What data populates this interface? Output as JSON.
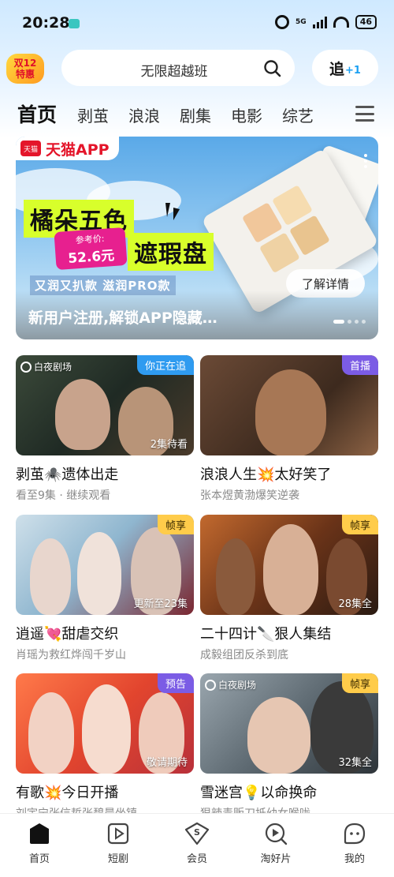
{
  "status_bar": {
    "time": "20:28",
    "network": "5G",
    "battery": "46"
  },
  "header": {
    "promo_badge": {
      "line1": "双12",
      "line2": "特惠"
    },
    "search": {
      "placeholder": "无限超越班"
    },
    "follow_button": {
      "label": "追",
      "plus": "+1"
    }
  },
  "tabs": [
    {
      "label": "首页",
      "active": true
    },
    {
      "label": "剥茧"
    },
    {
      "label": "浪浪"
    },
    {
      "label": "剧集"
    },
    {
      "label": "电影"
    },
    {
      "label": "综艺"
    }
  ],
  "banner": {
    "brand": "天猫APP",
    "brand_logo": "天猫",
    "headline1": "橘朵五色",
    "price_label": "参考价:",
    "price": "52.6元",
    "headline2": "遮瑕盘",
    "subline": "又润又扒款 滋润PRO款",
    "cta": "了解详情",
    "caption": "新用户注册,解锁APP隐藏…",
    "pager_total": 4,
    "pager_active": 1
  },
  "cards": [
    {
      "title": "剥茧🕷️遗体出走",
      "subtitle": "看至9集 · 继续观看",
      "badge": "你正在追",
      "badge_color": "blue",
      "overlay": "2集待看",
      "watermark": "白夜剧场"
    },
    {
      "title": "浪浪人生💥太好笑了",
      "subtitle": "张本煜黄渤爆笑逆袭",
      "badge": "首播",
      "badge_color": "purple",
      "overlay": "",
      "watermark": ""
    },
    {
      "title": "逍遥💘甜虐交织",
      "subtitle": "肖瑶为救红烨闯千岁山",
      "badge": "帧享",
      "badge_color": "orange",
      "overlay": "更新至23集",
      "watermark": ""
    },
    {
      "title": "二十四计🔪狠人集结",
      "subtitle": "成毅组团反杀到底",
      "badge": "帧享",
      "badge_color": "orange",
      "overlay": "28集全",
      "watermark": ""
    },
    {
      "title": "有歌💥今日开播",
      "subtitle": "刘宇宁张信哲张碧晨坐镇",
      "badge": "预告",
      "badge_color": "purple",
      "overlay": "敬请期待",
      "watermark": ""
    },
    {
      "title": "雪迷宫💡以命换命",
      "subtitle": "狠辣毒贩刀抵幼女喉咙",
      "badge": "帧享",
      "badge_color": "orange",
      "overlay": "32集全",
      "watermark": "白夜剧场"
    }
  ],
  "bottom_nav": [
    {
      "label": "首页",
      "icon": "home-icon",
      "active": true
    },
    {
      "label": "短剧",
      "icon": "play-icon"
    },
    {
      "label": "会员",
      "icon": "vip-icon"
    },
    {
      "label": "淘好片",
      "icon": "search-play-icon"
    },
    {
      "label": "我的",
      "icon": "profile-icon"
    }
  ]
}
